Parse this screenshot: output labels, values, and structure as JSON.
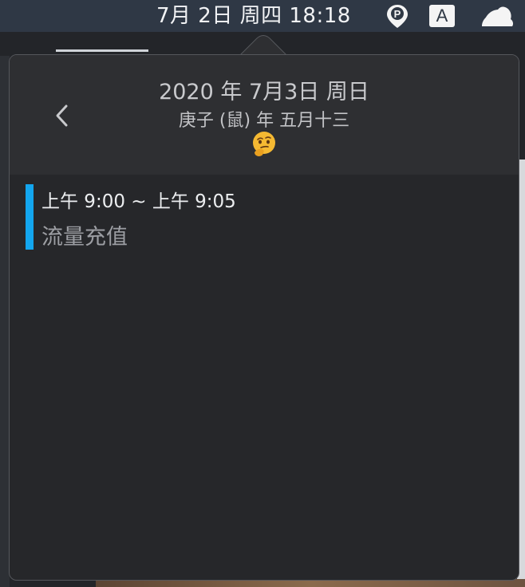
{
  "menubar": {
    "clock": "7月 2日 周四 18:18",
    "pin_app_icon": "pin-app-icon",
    "input_source_label": "A",
    "cloud_app_icon": "cloud-icon"
  },
  "popover": {
    "date_title": "2020 年 7月3日 周日",
    "lunar_date": "庚子 (鼠) 年 五月十三",
    "emoji_icon": "thinking-face-emoji",
    "back_icon": "chevron-left-icon",
    "events": [
      {
        "time": "上午 9:00 ~ 上午 9:05",
        "title": "流量充值",
        "color": "#13a6ef"
      }
    ]
  }
}
